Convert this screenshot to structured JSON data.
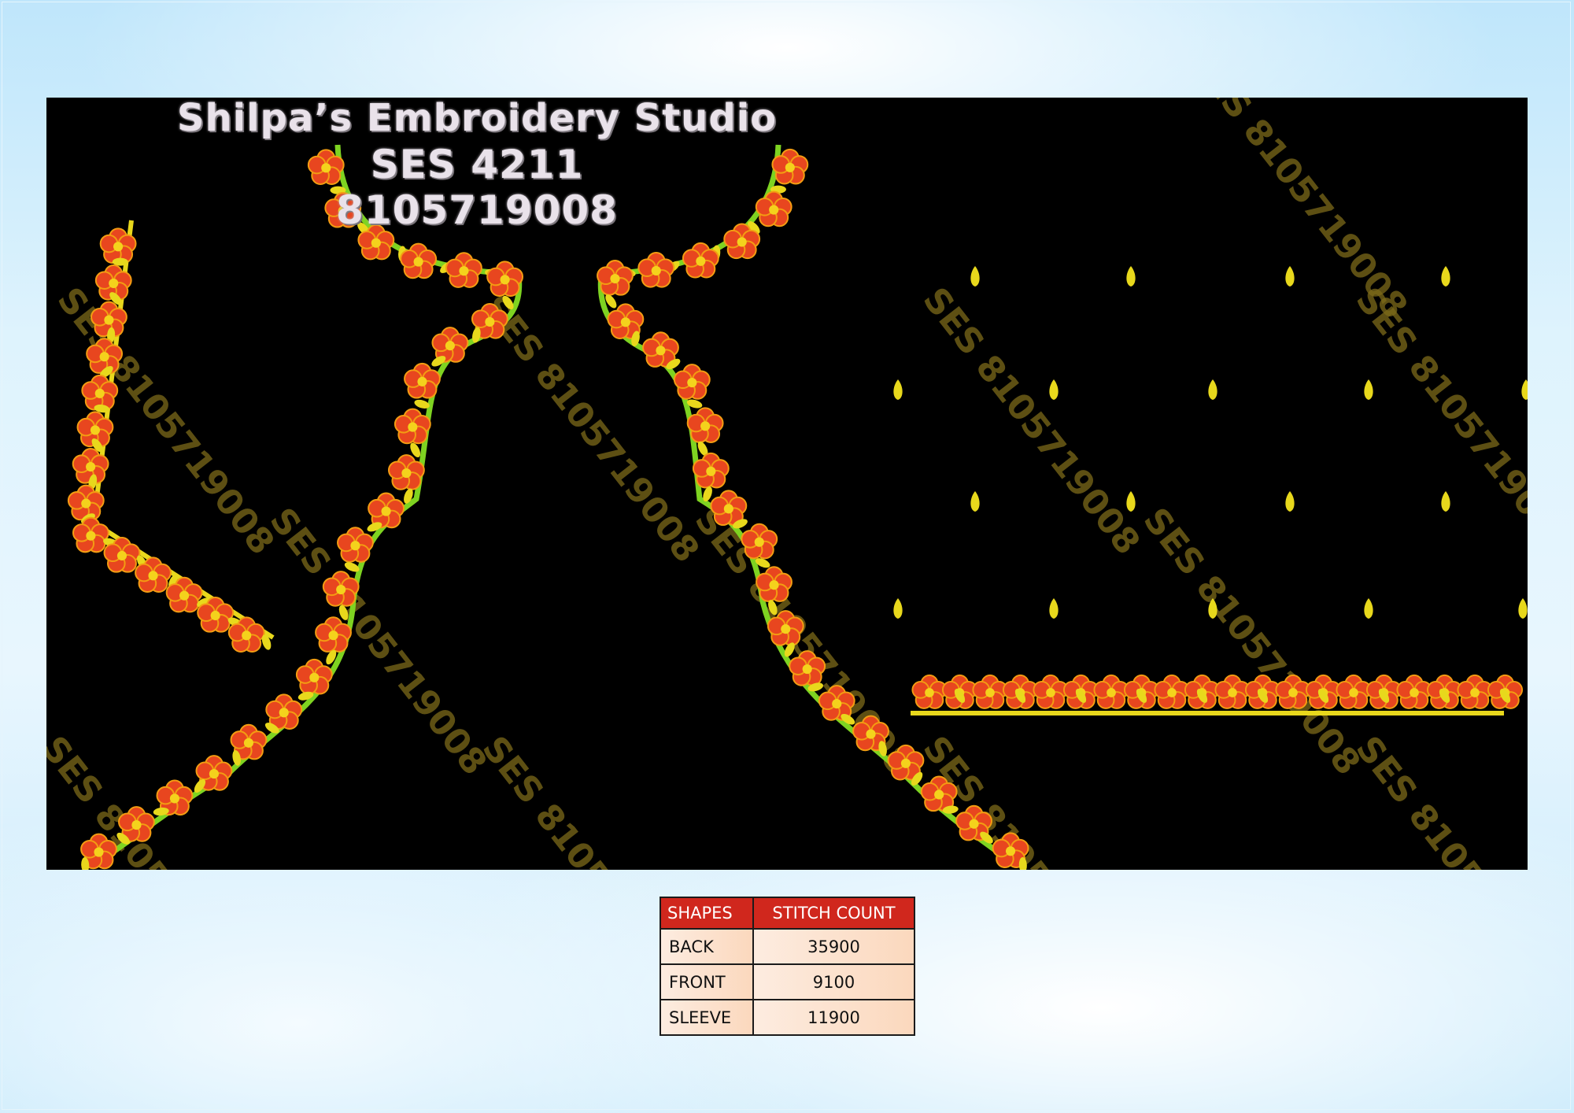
{
  "design": {
    "studio_name": "Shilpa’s Embroidery Studio",
    "design_code": "SES 4211",
    "phone": "8105719008",
    "watermark_text": "SES 8105719008",
    "colors": {
      "background": "#000000",
      "flower": "#e8461f",
      "flower_center": "#f4d21c",
      "leaf": "#e8d81c",
      "outline": "#7ed321"
    }
  },
  "table": {
    "headers": [
      "SHAPES",
      "STITCH COUNT"
    ],
    "rows": [
      {
        "shape": "BACK",
        "count": "35900"
      },
      {
        "shape": "FRONT",
        "count": "9100"
      },
      {
        "shape": "SLEEVE",
        "count": "11900"
      }
    ]
  }
}
